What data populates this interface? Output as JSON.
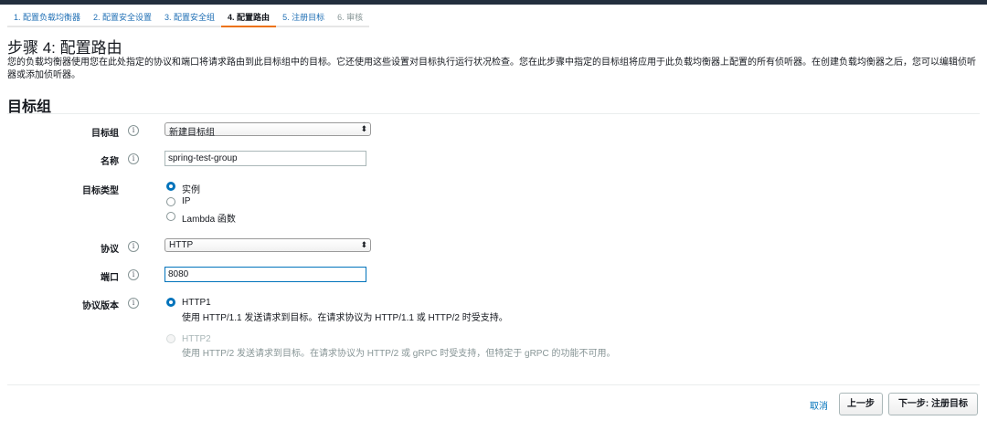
{
  "steps": [
    {
      "label": "1. 配置负载均衡器",
      "state": "link"
    },
    {
      "label": "2. 配置安全设置",
      "state": "link"
    },
    {
      "label": "3. 配置安全组",
      "state": "link"
    },
    {
      "label": "4. 配置路由",
      "state": "active"
    },
    {
      "label": "5. 注册目标",
      "state": "link"
    },
    {
      "label": "6. 审核",
      "state": "disabled"
    }
  ],
  "page": {
    "title": "步骤 4: 配置路由",
    "description": "您的负载均衡器使用您在此处指定的协议和端口将请求路由到此目标组中的目标。它还使用这些设置对目标执行运行状况检查。您在此步骤中指定的目标组将应用于此负载均衡器上配置的所有侦听器。在创建负载均衡器之后，您可以编辑侦听器或添加侦听器。"
  },
  "section": {
    "title": "目标组"
  },
  "form": {
    "target_group": {
      "label": "目标组",
      "value": "新建目标组"
    },
    "name": {
      "label": "名称",
      "value": "spring-test-group"
    },
    "target_type": {
      "label": "目标类型",
      "options": [
        "实例",
        "IP",
        "Lambda 函数"
      ],
      "selected": "实例"
    },
    "protocol": {
      "label": "协议",
      "value": "HTTP"
    },
    "port": {
      "label": "端口",
      "value": "8080"
    },
    "protocol_version": {
      "label": "协议版本",
      "options": [
        {
          "label": "HTTP1",
          "desc": "使用 HTTP/1.1 发送请求到目标。在请求协议为 HTTP/1.1 或 HTTP/2 时受支持。",
          "selected": true,
          "enabled": true
        },
        {
          "label": "HTTP2",
          "desc": "使用 HTTP/2 发送请求到目标。在请求协议为 HTTP/2 或 gRPC 时受支持，但特定于 gRPC 的功能不可用。",
          "selected": false,
          "enabled": false
        }
      ]
    },
    "info_icon": "i"
  },
  "footer": {
    "cancel": "取消",
    "previous": "上一步",
    "next": "下一步: 注册目标"
  },
  "colors": {
    "accent": "#ec7211",
    "link": "#0073bb",
    "topbar": "#232f3e"
  }
}
